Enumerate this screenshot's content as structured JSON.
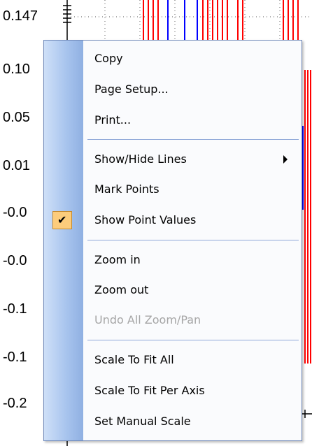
{
  "plot": {
    "y_ticks": [
      "0.147",
      "0.10",
      "0.05",
      "0.01",
      "-0.0",
      "-0.0",
      "-0.1",
      "-0.1",
      "-0.2"
    ],
    "series_colors": {
      "red": "#ff0000",
      "blue": "#0000ff"
    }
  },
  "menu": {
    "items": [
      {
        "label": "Copy",
        "enabled": true
      },
      {
        "label": "Page Setup...",
        "enabled": true
      },
      {
        "label": "Print...",
        "enabled": true
      },
      {
        "label": "Show/Hide Lines",
        "enabled": true,
        "submenu": true
      },
      {
        "label": "Mark Points",
        "enabled": true
      },
      {
        "label": "Show Point Values",
        "enabled": true,
        "checked": true
      },
      {
        "label": "Zoom in",
        "enabled": true
      },
      {
        "label": "Zoom out",
        "enabled": true
      },
      {
        "label": "Undo All Zoom/Pan",
        "enabled": false
      },
      {
        "label": "Scale To Fit All",
        "enabled": true
      },
      {
        "label": "Scale To Fit Per Axis",
        "enabled": true
      },
      {
        "label": "Set Manual Scale",
        "enabled": true
      }
    ]
  },
  "icons": {
    "checked": "checkmark-icon",
    "submenu": "submenu-arrow-icon"
  }
}
